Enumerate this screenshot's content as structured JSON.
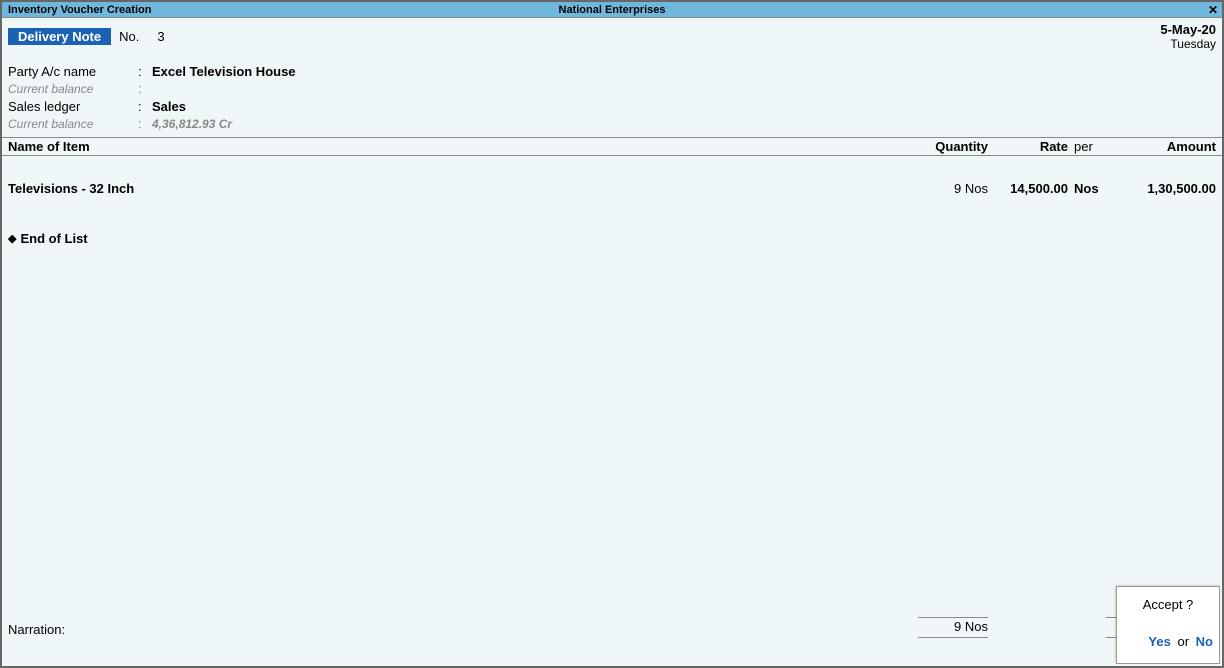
{
  "title_bar": {
    "left": "Inventory Voucher Creation",
    "center": "National Enterprises",
    "close": "✕"
  },
  "voucher": {
    "type": "Delivery Note",
    "no_label": "No.",
    "no_value": "3",
    "date": "5-May-20",
    "day": "Tuesday"
  },
  "party": {
    "name_label": "Party A/c name",
    "name_value": "Excel Television House",
    "balance_label": "Current balance",
    "balance_value": "",
    "ledger_label": "Sales ledger",
    "ledger_value": "Sales",
    "ledger_balance_label": "Current balance",
    "ledger_balance_value": "4,36,812.93 Cr"
  },
  "columns": {
    "name": "Name of Item",
    "quantity": "Quantity",
    "rate": "Rate",
    "per": "per",
    "amount": "Amount"
  },
  "items": [
    {
      "name": "Televisions - 32 Inch",
      "quantity": "9 Nos",
      "rate": "14,500.00",
      "per": "Nos",
      "amount": "1,30,500.00"
    }
  ],
  "end_of_list": "End of List",
  "totals": {
    "quantity": "9 Nos",
    "amount": ""
  },
  "narration_label": "Narration:",
  "accept": {
    "title": "Accept ?",
    "yes": "Yes",
    "or": "or",
    "no": "No"
  }
}
